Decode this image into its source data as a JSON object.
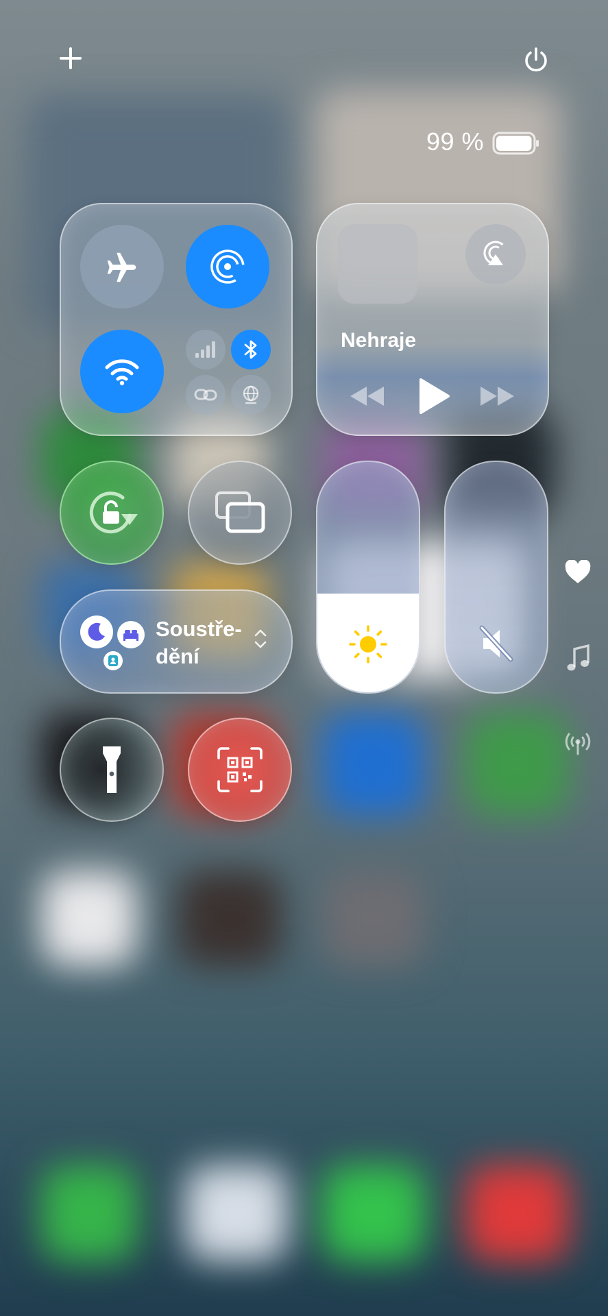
{
  "top_bar": {
    "add_icon": "plus-icon",
    "power_icon": "power-icon"
  },
  "status": {
    "battery_text": "99 %",
    "battery_level": 0.99
  },
  "connectivity": {
    "airplane_mode": {
      "icon": "airplane-icon",
      "on": false
    },
    "airdrop": {
      "icon": "airdrop-icon",
      "on": true
    },
    "wifi": {
      "icon": "wifi-icon",
      "on": true
    },
    "cellular": {
      "icon": "cellular-signal-icon",
      "on": false
    },
    "bluetooth": {
      "icon": "bluetooth-icon",
      "on": true
    },
    "personal_hotspot": {
      "icon": "hotspot-link-icon",
      "on": false
    },
    "vpn": {
      "icon": "globe-icon",
      "on": false
    }
  },
  "media": {
    "title": "Nehraje",
    "airplay_icon": "airplay-icon",
    "rewind_icon": "rewind-icon",
    "play_icon": "play-icon",
    "forward_icon": "fast-forward-icon"
  },
  "controls": {
    "orientation_lock": {
      "icon": "rotation-lock-icon",
      "on": true
    },
    "screen_mirroring": {
      "icon": "screen-mirroring-icon"
    },
    "focus": {
      "label": "Soustře-\ndění",
      "icons": [
        "moon-icon",
        "bed-icon",
        "person-badge-icon"
      ]
    },
    "brightness": {
      "icon": "sun-icon",
      "level": 0.43
    },
    "volume": {
      "icon": "speaker-muted-icon",
      "level": 0.0
    },
    "flashlight": {
      "icon": "flashlight-icon"
    },
    "code_scanner": {
      "icon": "qr-code-icon"
    }
  },
  "side_page_indicators": [
    "heart-icon",
    "music-note-icon",
    "antenna-icon"
  ],
  "colors": {
    "accent_blue": "#1a8cff",
    "orientation_green": "#34c759",
    "scanner_red": "#e0524c",
    "focus_purple": "#5e5ce6",
    "sun_yellow": "#ffcc00"
  }
}
